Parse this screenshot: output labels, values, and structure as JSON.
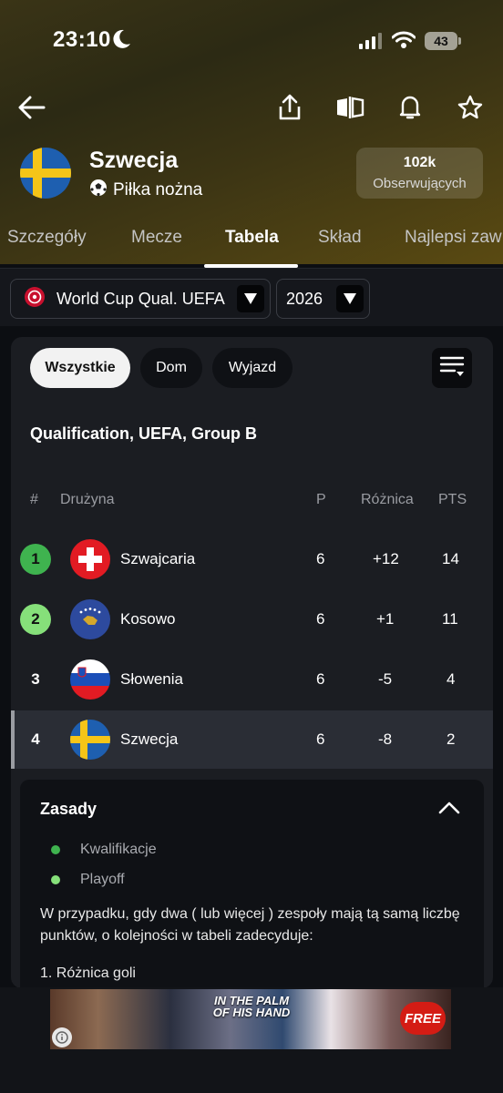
{
  "status_bar": {
    "time": "23:10",
    "battery": "43"
  },
  "team": {
    "name": "Szwecja",
    "sport": "Piłka nożna",
    "followers_count": "102k",
    "followers_label": "Obserwujących"
  },
  "tabs": [
    {
      "label": "Szczegóły",
      "active": false
    },
    {
      "label": "Mecze",
      "active": false
    },
    {
      "label": "Tabela",
      "active": true
    },
    {
      "label": "Skład",
      "active": false
    },
    {
      "label": "Najlepsi zaw",
      "active": false
    }
  ],
  "filters": {
    "competition": "World Cup Qual. UEFA",
    "season": "2026"
  },
  "venue_filters": [
    {
      "label": "Wszystkie",
      "active": true
    },
    {
      "label": "Dom",
      "active": false
    },
    {
      "label": "Wyjazd",
      "active": false
    }
  ],
  "group_title": "Qualification, UEFA, Group B",
  "table": {
    "headers": {
      "rank": "#",
      "team": "Drużyna",
      "played": "P",
      "diff": "Różnica",
      "pts": "PTS"
    },
    "rows": [
      {
        "rank": "1",
        "team": "Szwajcaria",
        "played": "6",
        "diff": "+12",
        "pts": "14",
        "status_color": "#3fb34f",
        "flag": "switzerland"
      },
      {
        "rank": "2",
        "team": "Kosowo",
        "played": "6",
        "diff": "+1",
        "pts": "11",
        "status_color": "#86e07a",
        "flag": "kosovo"
      },
      {
        "rank": "3",
        "team": "Słowenia",
        "played": "6",
        "diff": "-5",
        "pts": "4",
        "status_color": "",
        "flag": "slovenia"
      },
      {
        "rank": "4",
        "team": "Szwecja",
        "played": "6",
        "diff": "-8",
        "pts": "2",
        "status_color": "",
        "flag": "sweden",
        "highlighted": true
      }
    ]
  },
  "rules": {
    "title": "Zasady",
    "legend": [
      {
        "label": "Kwalifikacje",
        "color": "#3fb34f"
      },
      {
        "label": "Playoff",
        "color": "#86e07a"
      }
    ],
    "text": "W przypadku, gdy dwa ( lub więcej ) zespoły mają tą samą liczbę punktów, o kolejności w tabeli zadecyduje:",
    "first_item": "1. Różnica goli"
  },
  "ad": {
    "title": "IN THE PALM OF HIS HAND",
    "cta": "FREE"
  }
}
